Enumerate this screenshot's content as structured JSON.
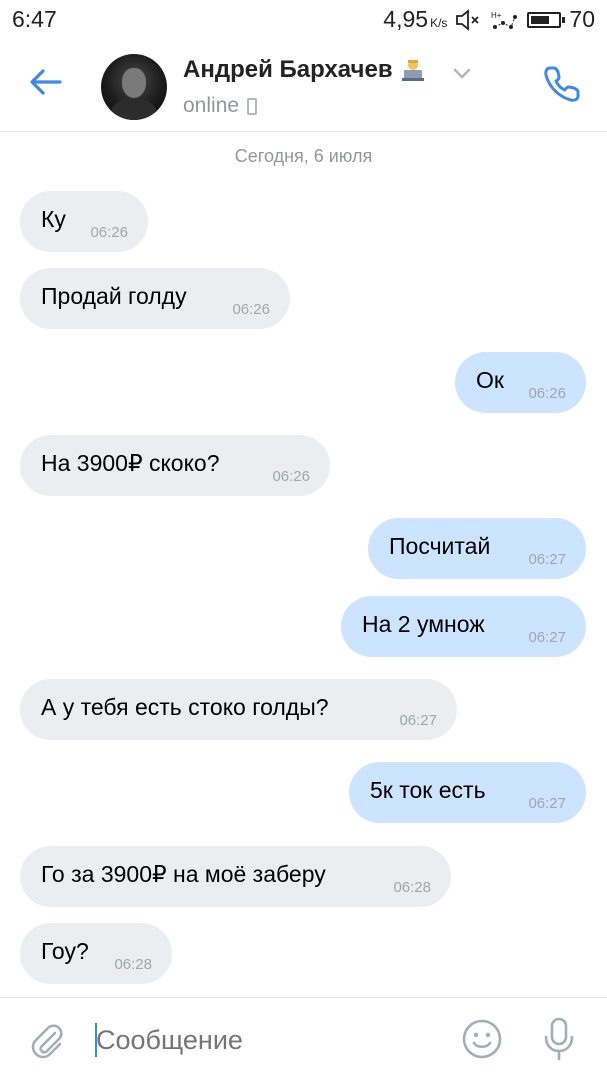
{
  "status_bar": {
    "time": "6:47",
    "speed": "4,95",
    "speed_unit": "K/s",
    "network": "H+",
    "battery": "70",
    "battery_level": 0.7
  },
  "header": {
    "contact_name": "Андрей Бархачев",
    "status": "online",
    "badge_icon": "laptop-person-icon",
    "accent_color": "#3f8ae0"
  },
  "date_separator": "Сегодня, 6 июля",
  "messages": [
    {
      "dir": "in",
      "text": "Ку",
      "time": "06:26"
    },
    {
      "dir": "in",
      "text": "Продай голду",
      "time": "06:26"
    },
    {
      "dir": "out",
      "text": "Ок",
      "time": "06:26"
    },
    {
      "dir": "in",
      "text": "На 3900₽ скоко?",
      "time": "06:26"
    },
    {
      "dir": "out",
      "text": "Посчитай",
      "time": "06:27"
    },
    {
      "dir": "out",
      "text": "На 2 умнож",
      "time": "06:27"
    },
    {
      "dir": "in",
      "text": "А у тебя есть стоко голды?",
      "time": "06:27"
    },
    {
      "dir": "out",
      "text": "5к ток есть",
      "time": "06:27"
    },
    {
      "dir": "in",
      "text": "Го за 3900₽ на моё заберу",
      "time": "06:28"
    },
    {
      "dir": "in",
      "text": "Гоу?",
      "time": "06:28"
    }
  ],
  "composer": {
    "placeholder": "Сообщение"
  },
  "colors": {
    "incoming_bubble": "#ebedf0",
    "outgoing_bubble": "#cce4ff",
    "accent": "#3f8ae0"
  }
}
